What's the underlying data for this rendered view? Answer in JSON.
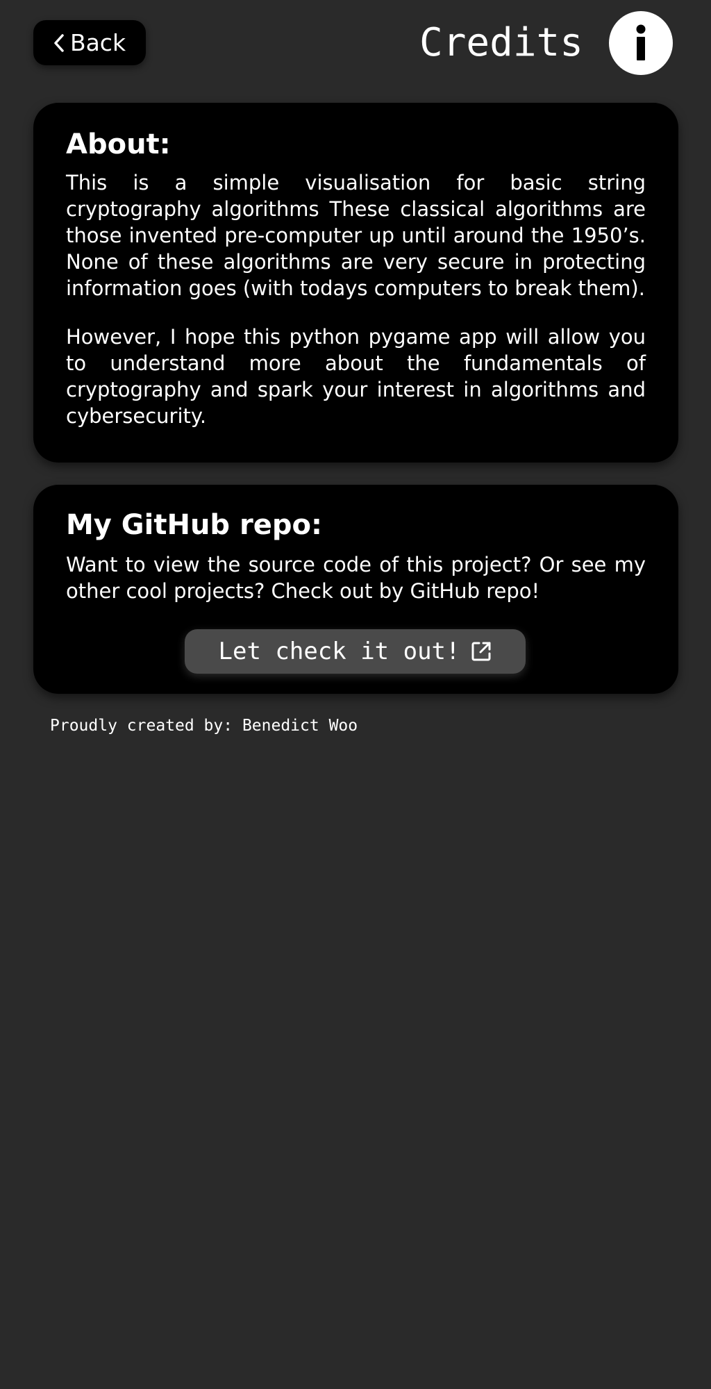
{
  "header": {
    "back_label": "Back",
    "title": "Credits",
    "back_icon": "chevron-left-icon",
    "info_icon": "info-icon"
  },
  "about": {
    "heading": "About:",
    "paragraph_1": "This is a simple visualisation for basic string cryptography algorithms These classical algorithms are those invented pre-computer up until around the 1950’s. None of these algorithms are very secure in protecting information goes (with todays computers to break them).",
    "paragraph_2": "However, I hope this python pygame app will allow you to understand more about the fundamentals of cryptography and spark your interest in algorithms and cybersecurity."
  },
  "github": {
    "heading": "My GitHub repo:",
    "description": "Want to view the source code of this project? Or see my other cool projects? Check out by GitHub repo!",
    "button_label": "Let check it out!",
    "button_icon": "external-link-icon"
  },
  "footer": {
    "credit": "Proudly created by: Benedict Woo"
  },
  "colors": {
    "background": "#2a2a2a",
    "card": "#000000",
    "button_dark": "#4a4a4a",
    "text": "#ffffff"
  }
}
